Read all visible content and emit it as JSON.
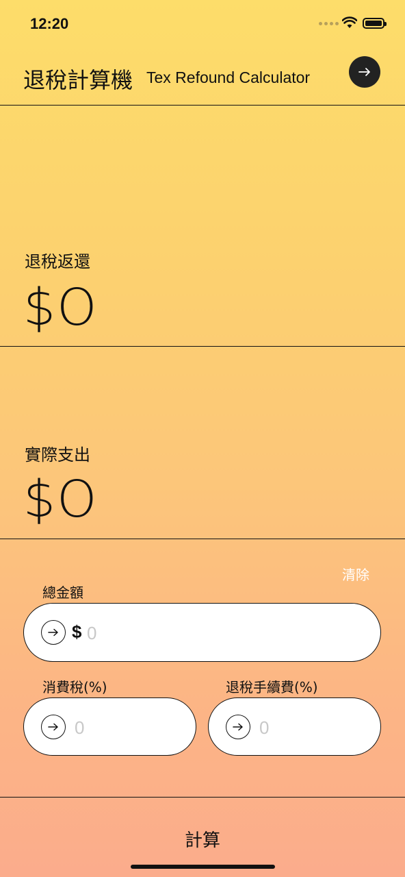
{
  "status_bar": {
    "time": "12:20",
    "icons": [
      "signal-dots",
      "wifi-icon",
      "battery-icon"
    ]
  },
  "header": {
    "title": "退稅計算機",
    "subtitle": "Tex Refound Calculator",
    "next_icon": "arrow-right-icon"
  },
  "refund": {
    "label": "退稅返還",
    "value": "$O"
  },
  "actual": {
    "label": "實際支出",
    "value": "$O"
  },
  "form": {
    "clear_label": "清除",
    "total": {
      "label": "總金額",
      "currency": "$",
      "value": "",
      "placeholder": "0"
    },
    "tax": {
      "label": "消費稅(%)",
      "value": "",
      "placeholder": "0"
    },
    "fee": {
      "label": "退稅手續費(%)",
      "value": "",
      "placeholder": "0"
    }
  },
  "calculate_label": "計算",
  "colors": {
    "gradient_top": "#FDDD6A",
    "gradient_bottom": "#FBAC8C",
    "clear_text": "#FFFFFF",
    "placeholder": "#C8C8C8"
  }
}
